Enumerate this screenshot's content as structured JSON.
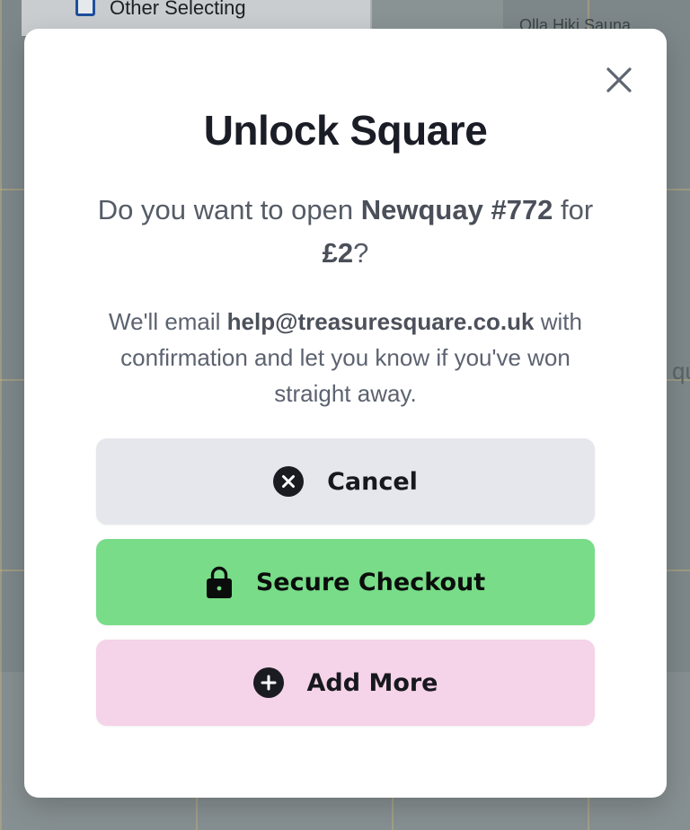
{
  "background": {
    "panel_label": "Other Selecting",
    "place_label": "Olla Hiki Sauna",
    "edge_text": "qu"
  },
  "modal": {
    "title": "Unlock Square",
    "question_prefix": "Do you want to open ",
    "square_name": "Newquay #772",
    "question_mid": " for ",
    "price": "£2",
    "question_suffix": "?",
    "info_prefix": "We'll email ",
    "email": "help@treasuresquare.co.uk",
    "info_suffix": " with confirmation and let you know if you've won straight away.",
    "buttons": {
      "cancel": "Cancel",
      "checkout": "Secure Checkout",
      "add_more": "Add More"
    },
    "colors": {
      "cancel_bg": "#e6e7ec",
      "checkout_bg": "#78dc88",
      "add_more_bg": "#f5d3e8"
    },
    "icons": {
      "close": "close-icon",
      "cancel": "x-circle-icon",
      "checkout": "lock-icon",
      "add_more": "plus-circle-icon"
    }
  }
}
